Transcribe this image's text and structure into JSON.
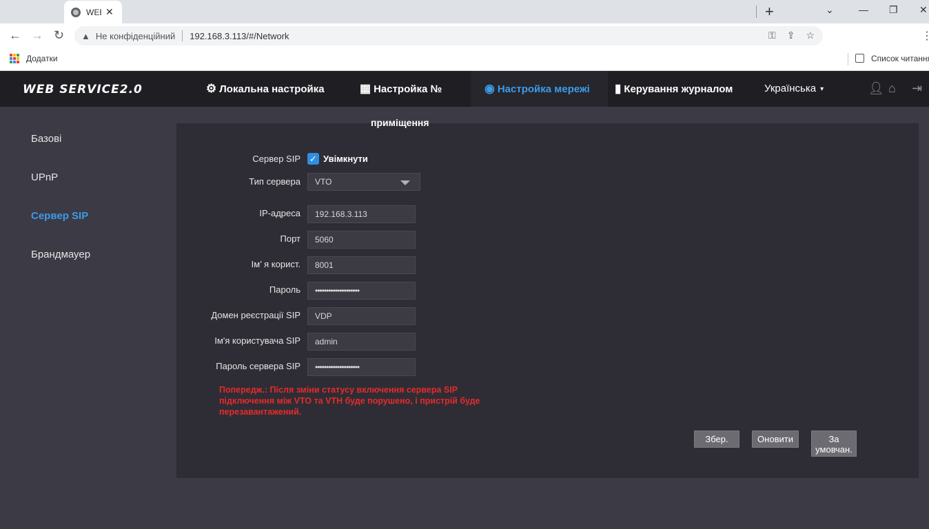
{
  "browser": {
    "tab_title": "WEB",
    "tab_close": "✕",
    "new_tab": "+",
    "not_secure": "Не конфіденційний",
    "url": "192.168.3.113/#/Network",
    "bookmarks_apps": "Додатки",
    "reading_list": "Список читання"
  },
  "app": {
    "logo": "WEB SERVICE2.0",
    "nav": [
      {
        "icon": "gear-icon",
        "label": "Локальна настройка"
      },
      {
        "icon": "building-icon",
        "label": "Настройка № приміщення"
      },
      {
        "icon": "globe-icon",
        "label": "Настройка мережі"
      },
      {
        "icon": "log-icon",
        "label": "Керування журналом"
      }
    ],
    "nav_part1": "Настройка №",
    "nav_part2": "приміщення",
    "language": "Українська"
  },
  "sidebar": {
    "items": [
      {
        "label": "Базові"
      },
      {
        "label": "UPnP"
      },
      {
        "label": "Сервер SIP"
      },
      {
        "label": "Брандмауер"
      }
    ]
  },
  "form": {
    "sip_server_label": "Сервер SIP",
    "enable_label": "Увімкнути",
    "enabled": true,
    "server_type_label": "Тип сервера",
    "server_type_value": "VTO",
    "ip_label": "IP-адреса",
    "ip_value": "192.168.3.113",
    "port_label": "Порт",
    "port_value": "5060",
    "username_label": "Ім’ я корист.",
    "username_value": "8001",
    "password_label": "Пароль",
    "password_value": "••••••••••••••••••••",
    "domain_label": "Домен реєстрації SIP",
    "domain_value": "VDP",
    "server_user_label": "Ім'я користувача SIP",
    "server_user_value": "admin",
    "server_pass_label": "Пароль сервера SIP",
    "server_pass_value": "••••••••••••••••••••",
    "warning": "Попередж.: Після зміни статусу включення сервера SIP підключення між VTO та VTH буде порушено, і пристрій буде перезавантажений."
  },
  "buttons": {
    "save": "Збер.",
    "refresh": "Оновити",
    "default_line1": "За",
    "default_line2": "умовчан."
  }
}
